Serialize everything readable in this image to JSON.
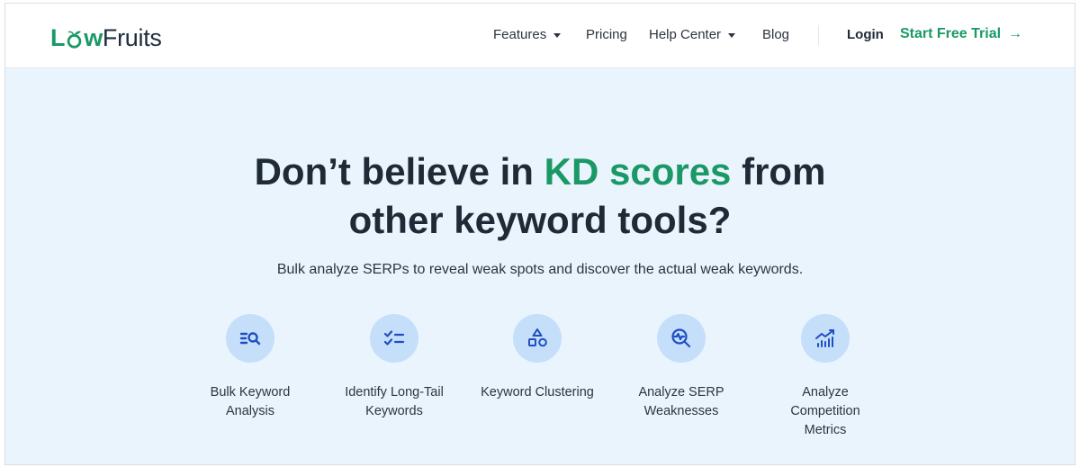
{
  "brand": {
    "part1": "L",
    "part2": "w",
    "part3": "Fruits",
    "accent_color": "#1a9966"
  },
  "nav": {
    "features": "Features",
    "pricing": "Pricing",
    "help_center": "Help Center",
    "blog": "Blog",
    "login": "Login",
    "trial": "Start Free Trial",
    "trial_arrow": "→"
  },
  "hero": {
    "headline_pre": "Don’t believe in",
    "headline_accent": "KD scores",
    "headline_post": "from",
    "headline_line2": "other keyword tools?",
    "subheadline": "Bulk analyze SERPs to reveal weak spots and discover the actual weak keywords."
  },
  "features": [
    {
      "icon": "search-list-icon",
      "line1": "Bulk Keyword",
      "line2": "Analysis",
      "line3": ""
    },
    {
      "icon": "checklist-icon",
      "line1": "Identify Long-Tail",
      "line2": "Keywords",
      "line3": ""
    },
    {
      "icon": "shapes-icon",
      "line1": "Keyword Clustering",
      "line2": "",
      "line3": ""
    },
    {
      "icon": "magnify-pulse-icon",
      "line1": "Analyze SERP",
      "line2": "Weaknesses",
      "line3": ""
    },
    {
      "icon": "chart-trend-icon",
      "line1": "Analyze",
      "line2": "Competition",
      "line3": "Metrics"
    }
  ],
  "colors": {
    "icon_blue": "#1e4fc2",
    "circle_bg": "#c5def9",
    "hero_bg": "#eaf4fd"
  }
}
